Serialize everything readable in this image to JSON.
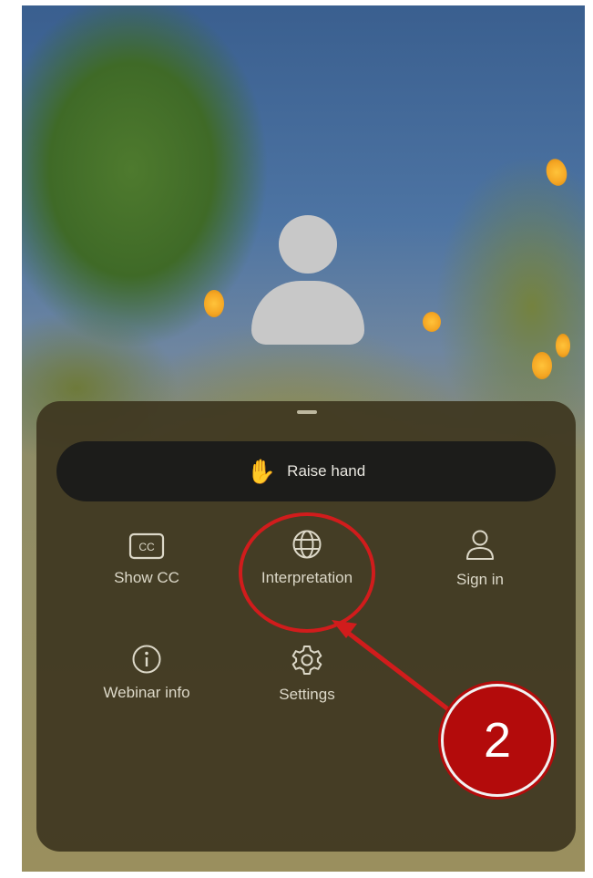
{
  "sheet": {
    "raise_hand_label": "Raise hand",
    "actions": [
      {
        "label": "Show CC",
        "icon": "cc-icon"
      },
      {
        "label": "Interpretation",
        "icon": "globe-icon"
      },
      {
        "label": "Sign in",
        "icon": "person-icon"
      },
      {
        "label": "Webinar info",
        "icon": "info-icon"
      },
      {
        "label": "Settings",
        "icon": "gear-icon"
      }
    ]
  },
  "annotation": {
    "step_number": "2",
    "color": "#d11c1c"
  },
  "colors": {
    "sheet_bg": "#3e3720",
    "pill_bg": "#1c1c1a",
    "text": "#dcd8c8"
  }
}
